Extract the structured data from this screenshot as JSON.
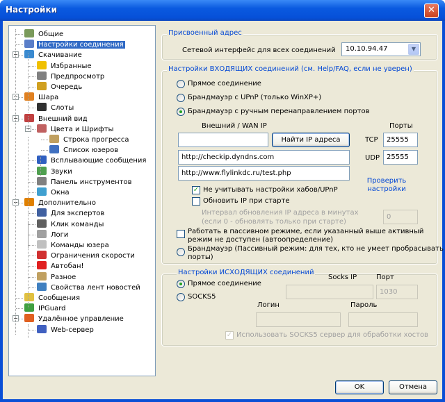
{
  "window": {
    "title": "Настройки",
    "close": "✕"
  },
  "tree": {
    "items": [
      {
        "label": "Общие",
        "icon": "users-icon",
        "color": "#7a9a5a"
      },
      {
        "label": "Настройки соединения",
        "icon": "network-icon",
        "color": "#5a7ec8"
      },
      {
        "label": "Скачивание",
        "icon": "download-icon",
        "color": "#3a8ad0"
      },
      {
        "label": "Избранные",
        "icon": "star-icon",
        "color": "#f0c000"
      },
      {
        "label": "Предпросмотр",
        "icon": "preview-icon",
        "color": "#808080"
      },
      {
        "label": "Очередь",
        "icon": "queue-icon",
        "color": "#d0a020"
      },
      {
        "label": "Шара",
        "icon": "share-icon",
        "color": "#e08020"
      },
      {
        "label": "Слоты",
        "icon": "slots-icon",
        "color": "#303030"
      },
      {
        "label": "Внешний вид",
        "icon": "appearance-icon",
        "color": "#c04040"
      },
      {
        "label": "Цвета и Шрифты",
        "icon": "palette-icon",
        "color": "#c06060"
      },
      {
        "label": "Строка прогресса",
        "icon": "progress-icon",
        "color": "#c0a060"
      },
      {
        "label": "Список юзеров",
        "icon": "userlist-icon",
        "color": "#4070c0"
      },
      {
        "label": "Всплывающие сообщения",
        "icon": "popup-icon",
        "color": "#3060c0"
      },
      {
        "label": "Звуки",
        "icon": "sound-icon",
        "color": "#50a050"
      },
      {
        "label": "Панель инструментов",
        "icon": "toolbar-icon",
        "color": "#808080"
      },
      {
        "label": "Окна",
        "icon": "windows-icon",
        "color": "#40a0d0"
      },
      {
        "label": "Дополнительно",
        "icon": "advanced-icon",
        "color": "#e08000"
      },
      {
        "label": "Для экспертов",
        "icon": "expert-icon",
        "color": "#4060a0"
      },
      {
        "label": "Клик команды",
        "icon": "click-icon",
        "color": "#606060"
      },
      {
        "label": "Логи",
        "icon": "logs-icon",
        "color": "#a0a0a0"
      },
      {
        "label": "Команды юзера",
        "icon": "usercmd-icon",
        "color": "#c0c0c0"
      },
      {
        "label": "Ограничения скорости",
        "icon": "speed-icon",
        "color": "#d03030"
      },
      {
        "label": "Автобан!",
        "icon": "autoban-icon",
        "color": "#e02020"
      },
      {
        "label": "Разное",
        "icon": "misc-icon",
        "color": "#c0a060"
      },
      {
        "label": "Свойства лент новостей",
        "icon": "rss-icon",
        "color": "#4080c0"
      },
      {
        "label": "Сообщения",
        "icon": "messages-icon",
        "color": "#e0c040"
      },
      {
        "label": "IPGuard",
        "icon": "ipguard-icon",
        "color": "#40a040"
      },
      {
        "label": "Удалённое управление",
        "icon": "remote-icon",
        "color": "#e06020"
      },
      {
        "label": "Web-сервер",
        "icon": "webserver-icon",
        "color": "#4060c0"
      }
    ]
  },
  "assigned": {
    "legend": "Присвоенный адрес",
    "label": "Сетевой интерфейс для всех соединений",
    "value": "10.10.94.47"
  },
  "incoming": {
    "legend": "Настройки ВХОДЯЩИХ соединений (см. Help/FAQ, если не уверен)",
    "direct": "Прямое соединение",
    "upnp": "Брандмауэр с UPnP (только WinXP+)",
    "manual": "Брандмауэр с ручным перенаправлением портов",
    "wan_label": "Внешний / WAN IP",
    "wan_value": "",
    "find_ip": "Найти IP адреса",
    "ports_label": "Порты",
    "tcp_label": "TCP",
    "tcp_value": "25555",
    "udp_label": "UDP",
    "udp_value": "25555",
    "url1": "http://checkip.dyndns.com",
    "url2": "http://www.flylinkdc.ru/test.php",
    "check_settings": "Проверить настройки",
    "ignore_hubs": "Не учитывать настройки хабов/UPnP",
    "update_ip": "Обновить IP при старте",
    "interval_line1": "Интервал обновления IP адреса в минутах",
    "interval_line2": "(если 0 - обновлять только при старте)",
    "interval_value": "0",
    "passive_line1": "Работать в пассивном режиме, если указанный выше активный",
    "passive_line2": "режим не доступен (автоопределение)",
    "fw_passive_line1": "Брандмауэр (Пассивный режим: для тех, кто не умеет пробрасывать",
    "fw_passive_line2": "порты)"
  },
  "outgoing": {
    "legend": "Настройки ИСХОДЯЩИХ соединений",
    "direct": "Прямое соединение",
    "socks": "SOCKS5",
    "socks_ip_label": "Socks IP",
    "port_label": "Порт",
    "port_value": "1030",
    "login_label": "Логин",
    "password_label": "Пароль",
    "use_socks": "Использовать SOCKS5 сервер для обработки хостов"
  },
  "buttons": {
    "ok": "OK",
    "cancel": "Отмена"
  }
}
